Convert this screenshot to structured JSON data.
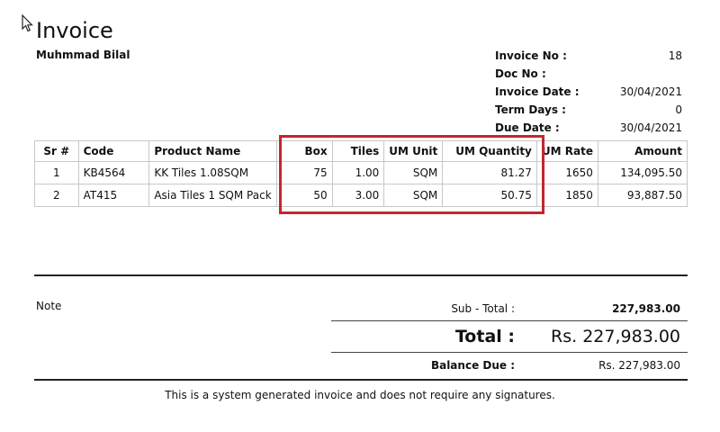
{
  "header": {
    "title": "Invoice",
    "company": "Muhmmad Bilal"
  },
  "meta": [
    {
      "label": "Invoice No :",
      "value": "18"
    },
    {
      "label": "Doc No :",
      "value": ""
    },
    {
      "label": "Invoice Date :",
      "value": "30/04/2021"
    },
    {
      "label": "Term Days :",
      "value": "0"
    },
    {
      "label": "Due Date :",
      "value": "30/04/2021"
    }
  ],
  "table": {
    "headers": [
      "Sr #",
      "Code",
      "Product Name",
      "Box",
      "Tiles",
      "UM Unit",
      "UM Quantity",
      "UM Rate",
      "Amount"
    ],
    "rows": [
      [
        "1",
        "KB4564",
        "KK Tiles 1.08SQM",
        "75",
        "1.00",
        "SQM",
        "81.27",
        "1650",
        "134,095.50"
      ],
      [
        "2",
        "AT415",
        "Asia Tiles 1 SQM Pack",
        "50",
        "3.00",
        "SQM",
        "50.75",
        "1850",
        "93,887.50"
      ]
    ]
  },
  "highlight_color": "#c4262e",
  "note_label": "Note",
  "totals": {
    "subtotal_label": "Sub - Total :",
    "subtotal_value": "227,983.00",
    "total_label": "Total :",
    "total_value": "Rs. 227,983.00",
    "balance_label": "Balance Due :",
    "balance_value": "Rs. 227,983.00"
  },
  "footer_text": "This is a system generated invoice and does not require any signatures."
}
